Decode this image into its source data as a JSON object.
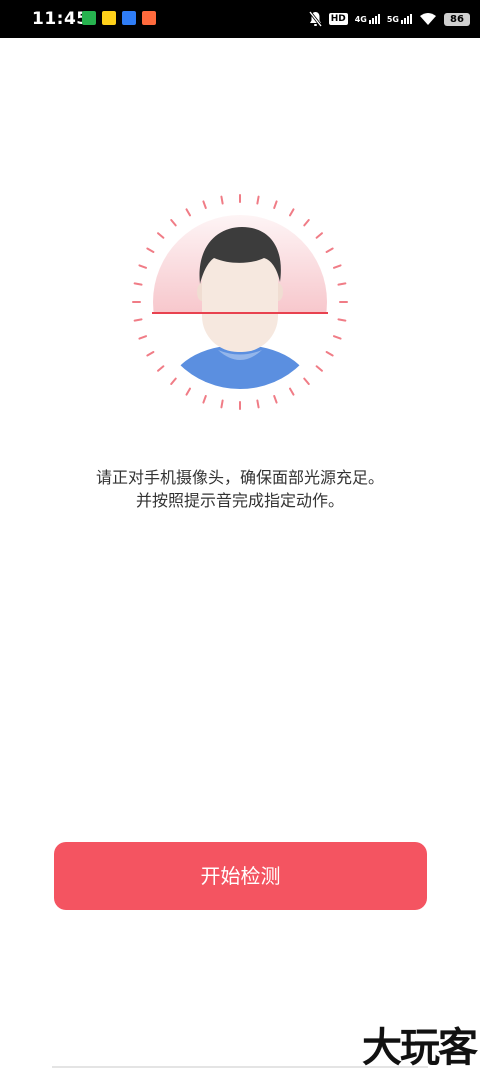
{
  "status_bar": {
    "time": "11:45",
    "network_1": "4G",
    "network_2": "5G",
    "hd": "HD",
    "battery": "86"
  },
  "instructions": {
    "line1": "请正对手机摄像头，确保面部光源充足。",
    "line2": "并按照提示音完成指定动作。"
  },
  "start_button": {
    "label": "开始检测"
  },
  "watermark": "大玩客",
  "colors": {
    "accent": "#f45461",
    "scan_line": "#e8424f",
    "tick": "#f07c86",
    "shirt": "#5b8fe0",
    "hair": "#3c3c3c",
    "skin": "#f6e8df"
  }
}
